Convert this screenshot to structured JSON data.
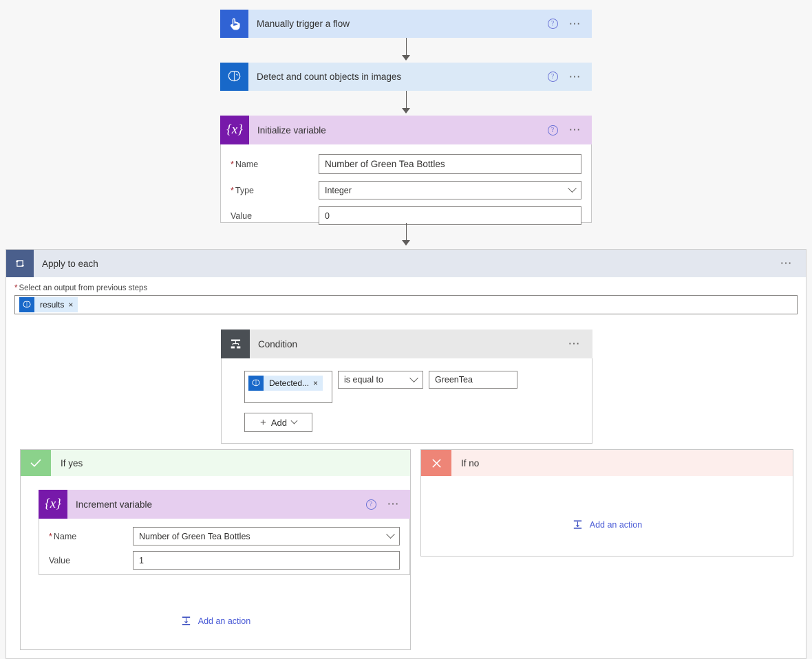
{
  "canvas": {
    "background": "#f7f7f7"
  },
  "steps": [
    {
      "id": "trigger",
      "title": "Manually trigger a flow",
      "icon": "manual-trigger-icon",
      "icon_bg": "#3063d4",
      "header_bg": "#d6e5f9",
      "has_help": true,
      "has_menu": true
    },
    {
      "id": "ai-builder",
      "title": "Detect and count objects in images",
      "icon": "ai-builder-brain-icon",
      "icon_bg": "#1868c9",
      "header_bg": "#dbe9f7",
      "has_help": true,
      "has_menu": true
    },
    {
      "id": "initialize-variable",
      "title": "Initialize variable",
      "icon": "variable-braces-icon",
      "icon_bg": "#7719aa",
      "header_bg": "#e6ceef",
      "has_help": true,
      "has_menu": true,
      "fields": [
        {
          "label": "Name",
          "required": true,
          "value": "Number of Green Tea Bottles",
          "control": "text"
        },
        {
          "label": "Type",
          "required": true,
          "value": "Integer",
          "control": "dropdown"
        },
        {
          "label": "Value",
          "required": false,
          "value": "0",
          "control": "text"
        }
      ]
    }
  ],
  "apply_to_each": {
    "title": "Apply to each",
    "icon": "loop-icon",
    "icon_bg": "#4a5f8c",
    "header_bg": "#e3e7ef",
    "has_menu": true,
    "output_label": "Select an output from previous steps",
    "output_required": true,
    "output_token": {
      "text": "results",
      "icon": "ai-builder-brain-icon",
      "remove": "×"
    }
  },
  "condition": {
    "title": "Condition",
    "icon": "condition-branch-icon",
    "icon_bg": "#4a4f54",
    "header_bg": "#e8e8e8",
    "has_menu": true,
    "left_token": {
      "text": "Detected...",
      "icon": "ai-builder-brain-icon",
      "remove": "×"
    },
    "operator": "is equal to",
    "right_value": "GreenTea",
    "add_button": {
      "plus": "+",
      "label": "Add",
      "caret": true
    }
  },
  "branches": {
    "yes": {
      "title": "If yes",
      "icon": "checkmark-icon",
      "icon_bg": "#8bd28b",
      "header_bg": "#eefaee",
      "action": {
        "title": "Increment variable",
        "icon": "variable-braces-icon",
        "icon_bg": "#7719aa",
        "header_bg": "#e6ceef",
        "has_help": true,
        "has_menu": true,
        "fields": [
          {
            "label": "Name",
            "required": true,
            "value": "Number of Green Tea Bottles",
            "control": "dropdown"
          },
          {
            "label": "Value",
            "required": false,
            "value": "1",
            "control": "text"
          }
        ]
      },
      "add_action_label": "Add an action",
      "add_action_icon": "insert-step-icon"
    },
    "no": {
      "title": "If no",
      "icon": "close-x-icon",
      "icon_bg": "#ee8577",
      "header_bg": "#fdeeec",
      "add_action_label": "Add an action",
      "add_action_icon": "insert-step-icon"
    }
  },
  "colors": {
    "accent_blue": "#3063d4",
    "variable_purple": "#7719aa",
    "link_blue": "#4a5bd6",
    "required_red": "#a4262c",
    "yes_green": "#8bd28b",
    "no_red": "#ee8577"
  }
}
